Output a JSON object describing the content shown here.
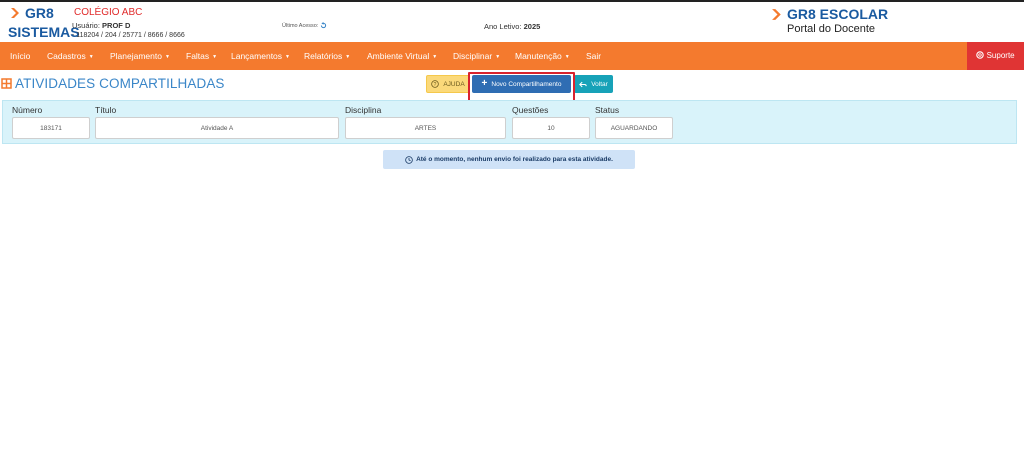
{
  "header": {
    "brand_left_line1": "GR8",
    "brand_left_line2": "SISTEMAS",
    "school": "COLÉGIO ABC",
    "user_label": "Usuário:",
    "user_name": "PROF D",
    "codes": "- 118204 / 204 / 25771 / 8666 / 8666",
    "last_access_label": "Último Acesso:",
    "year_label": "Ano Letivo:",
    "year_value": "2025",
    "brand_right_line1": "GR8 ESCOLAR",
    "brand_right_line2": "Portal do Docente"
  },
  "nav": {
    "items": [
      {
        "label": "Início",
        "dropdown": false
      },
      {
        "label": "Cadastros",
        "dropdown": true
      },
      {
        "label": "Planejamento",
        "dropdown": true
      },
      {
        "label": "Faltas",
        "dropdown": true
      },
      {
        "label": "Lançamentos",
        "dropdown": true
      },
      {
        "label": "Relatórios",
        "dropdown": true
      },
      {
        "label": "Ambiente Virtual",
        "dropdown": true
      },
      {
        "label": "Disciplinar",
        "dropdown": true
      },
      {
        "label": "Manutenção",
        "dropdown": true
      },
      {
        "label": "Sair",
        "dropdown": false
      }
    ],
    "support_label": "Suporte"
  },
  "page": {
    "title": "ATIVIDADES COMPARTILHADAS",
    "help_label": "AJUDA",
    "new_share_label": "Novo Compartilhamento",
    "back_label": "Voltar"
  },
  "fields": {
    "numero_label": "Número",
    "numero_value": "183171",
    "titulo_label": "Título",
    "titulo_value": "Atividade A",
    "disciplina_label": "Disciplina",
    "disciplina_value": "ARTES",
    "questoes_label": "Questões",
    "questoes_value": "10",
    "status_label": "Status",
    "status_value": "AGUARDANDO"
  },
  "notice": "Até o momento, nenhum envio foi realizado para esta atividade.",
  "colors": {
    "nav": "#f47a2e",
    "support": "#e03434",
    "title": "#3a86c8",
    "primary": "#2f6db3",
    "info": "#17a2b8",
    "panel": "#d9f3fa",
    "highlight": "#d9232e"
  }
}
